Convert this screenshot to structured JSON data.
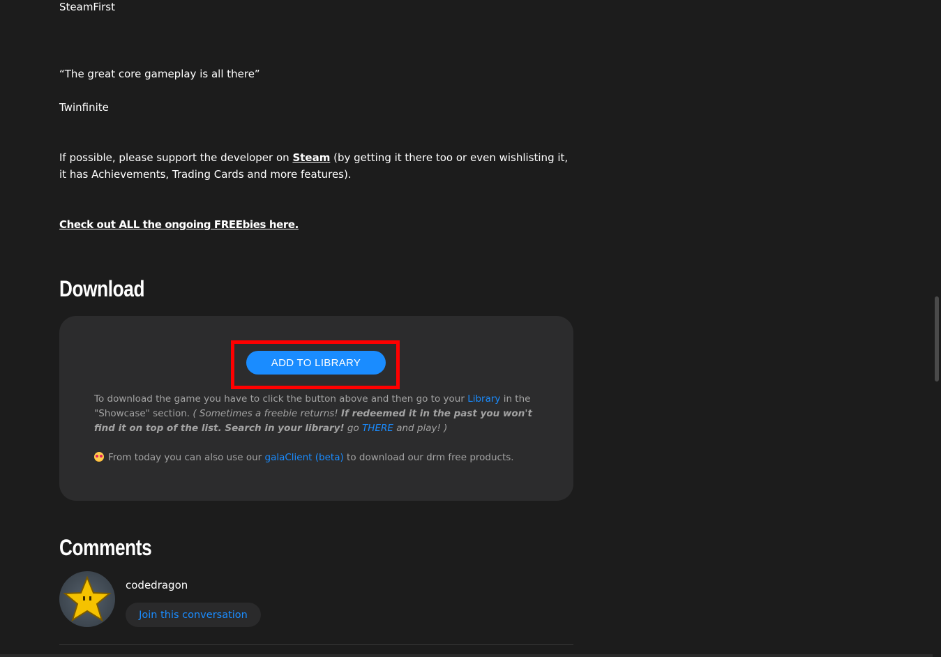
{
  "article": {
    "source_1": "SteamFirst",
    "quote_2": "“The great core gameplay is all there”",
    "source_2": "Twinfinite",
    "support_prefix": "If possible, please support the developer on ",
    "support_link": "Steam",
    "support_suffix": " (by getting it there too or even wishlisting it, it has Achievements, Trading Cards and more features).",
    "freebies_link": "Check out ALL the ongoing FREEbies here."
  },
  "download": {
    "heading": "Download",
    "add_button": "ADD TO LIBRARY",
    "instr_prefix": "To download the game you have to click the button above and then go to your ",
    "library_link": "Library",
    "instr_middle": " in the \"Showcase\" section. ",
    "note_open": "( Sometimes a freebie returns! ",
    "note_bold": "If redeemed it in the past you won't find it on top of the list. Search in your library!",
    "note_go": " go ",
    "there_link": "THERE",
    "note_close": " and play! )",
    "client_prefix": "From today you can also use our ",
    "client_link": "galaClient (beta)",
    "client_suffix": " to download our drm free products."
  },
  "comments": {
    "heading": "Comments",
    "username": "codedragon",
    "join_button": "Join this conversation"
  },
  "icons": {
    "emoji": "star-struck-emoji-icon",
    "avatar": "star-avatar"
  },
  "colors": {
    "background": "#1c1c1c",
    "panel": "#2c2c2d",
    "accent": "#1a8cff",
    "highlight": "#ff0000",
    "muted_text": "#a3a3a3"
  }
}
